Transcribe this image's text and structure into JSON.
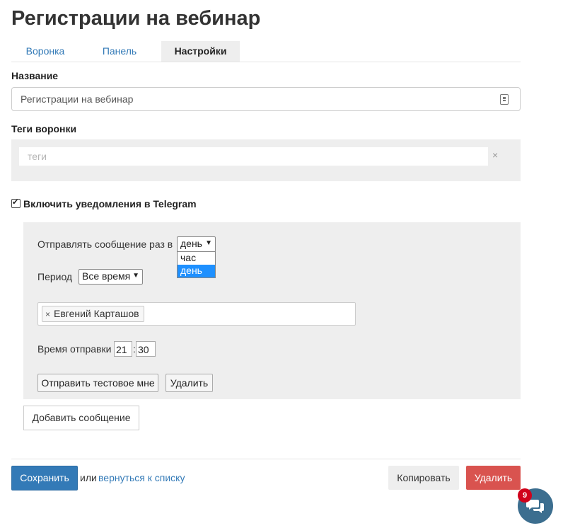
{
  "page": {
    "title": "Регистрации на вебинар"
  },
  "tabs": [
    {
      "label": "Воронка",
      "active": false
    },
    {
      "label": "Панель",
      "active": false
    },
    {
      "label": "Настройки",
      "active": true
    }
  ],
  "form": {
    "name_label": "Название",
    "name_value": "Регистрации на вебинар",
    "tags_label": "Теги воронки",
    "tags_placeholder": "теги",
    "tags_clear": "×",
    "telegram_checkbox_label": "Включить уведомления в Telegram",
    "telegram_checked": true
  },
  "notification": {
    "send_label": "Отправлять сообщение раз в",
    "frequency_selected": "день",
    "frequency_options": [
      {
        "label": "час",
        "selected": false
      },
      {
        "label": "день",
        "selected": true
      }
    ],
    "period_label": "Период",
    "period_selected": "Все время",
    "recipients": [
      {
        "name": "Евгений Карташов",
        "remove": "×"
      }
    ],
    "time_label": "Время отправки",
    "time_hours": "21",
    "time_separator": ":",
    "time_minutes": "30",
    "test_button": "Отправить тестовое мне",
    "delete_button": "Удалить"
  },
  "add_message_button": "Добавить сообщение",
  "footer": {
    "save_button": "Сохранить",
    "or_text": "или",
    "back_link": "вернуться к списку",
    "copy_button": "Копировать",
    "delete_button": "Удалить"
  },
  "chat": {
    "badge_count": "9"
  },
  "colors": {
    "primary": "#337ab7",
    "danger": "#d9534f",
    "panel_bg": "#eeeeee",
    "dropdown_selected": "#1e90ff",
    "chat_bg": "#3c6e8f",
    "badge": "#d0021b"
  }
}
